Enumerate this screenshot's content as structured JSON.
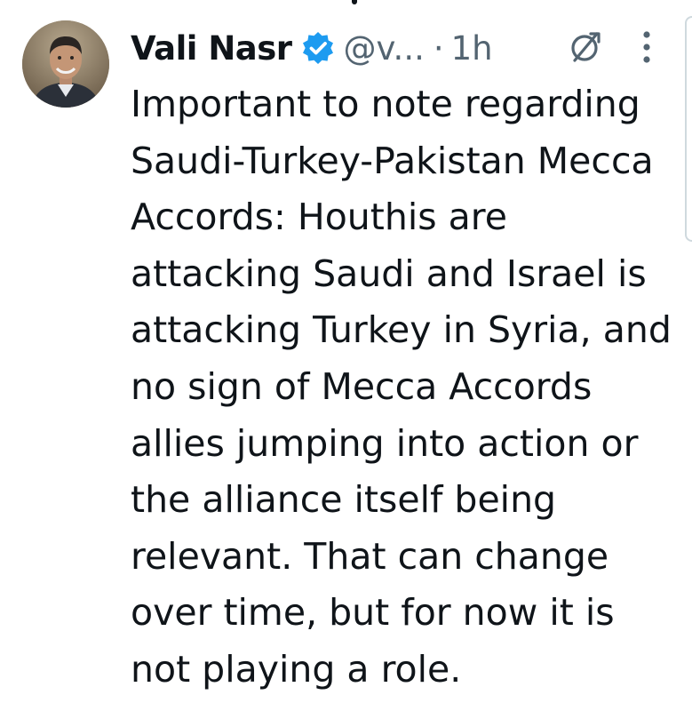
{
  "tweet": {
    "author": {
      "display_name": "Vali Nasr",
      "handle": "@v...",
      "verified_icon": "verified-badge-icon"
    },
    "separator": "·",
    "time": "1h",
    "icons": {
      "grok": "grok-icon",
      "more": "more-vertical-icon"
    },
    "text": "Important to note regarding Saudi-Turkey-Pakistan Mecca Accords: Houthis are attacking Saudi and Israel is attacking Turkey in Syria, and no sign of Mecca Accords allies jumping into action or the alliance itself being relevant. That can change over time, but for now it is not playing a role."
  },
  "colors": {
    "text": "#0f1419",
    "secondary": "#536471",
    "verified": "#1d9bf0"
  }
}
